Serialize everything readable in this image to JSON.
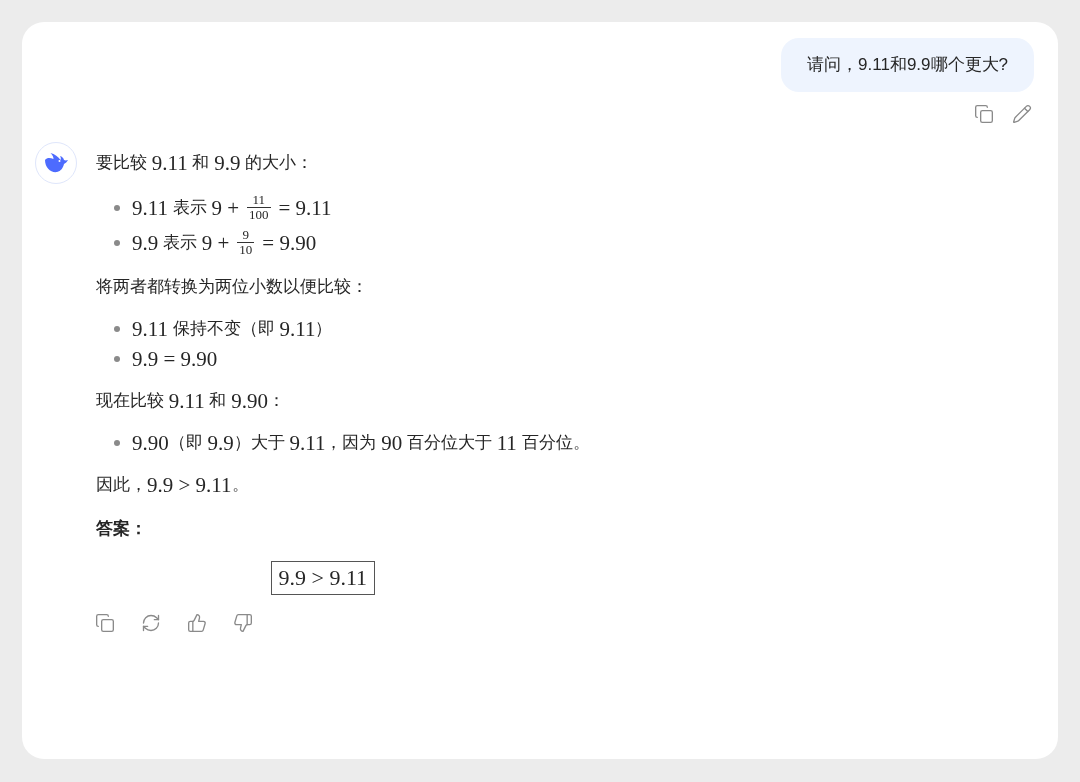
{
  "user_message": {
    "text": "请问，9.11和9.9哪个更大?"
  },
  "user_actions": [
    {
      "kind": "copy"
    },
    {
      "kind": "edit"
    }
  ],
  "answer": [
    {
      "kind": "paragraph",
      "segments": [
        {
          "kind": "text",
          "text": "要比较 "
        },
        {
          "kind": "math",
          "text": "9.11"
        },
        {
          "kind": "text",
          "text": " 和 "
        },
        {
          "kind": "math",
          "text": "9.9"
        },
        {
          "kind": "text",
          "text": " 的大小："
        }
      ]
    },
    {
      "kind": "list",
      "items": [
        [
          {
            "kind": "math",
            "text": "9.11"
          },
          {
            "kind": "text",
            "text": " 表示 "
          },
          {
            "kind": "math",
            "text": "9 +"
          },
          {
            "kind": "frac",
            "num": "11",
            "den": "100"
          },
          {
            "kind": "math",
            "text": "= 9.11"
          }
        ],
        [
          {
            "kind": "math",
            "text": "9.9"
          },
          {
            "kind": "text",
            "text": " 表示 "
          },
          {
            "kind": "math",
            "text": "9 +"
          },
          {
            "kind": "frac",
            "num": "9",
            "den": "10"
          },
          {
            "kind": "math",
            "text": "= 9.90"
          }
        ]
      ]
    },
    {
      "kind": "paragraph",
      "segments": [
        {
          "kind": "text",
          "text": "将两者都转换为两位小数以便比较："
        }
      ]
    },
    {
      "kind": "list",
      "items": [
        [
          {
            "kind": "math",
            "text": "9.11"
          },
          {
            "kind": "text",
            "text": " 保持不变（即 "
          },
          {
            "kind": "math",
            "text": "9.11"
          },
          {
            "kind": "text",
            "text": "）"
          }
        ],
        [
          {
            "kind": "math",
            "text": "9.9 = 9.90"
          }
        ]
      ]
    },
    {
      "kind": "paragraph",
      "segments": [
        {
          "kind": "text",
          "text": "现在比较 "
        },
        {
          "kind": "math",
          "text": "9.11"
        },
        {
          "kind": "text",
          "text": " 和 "
        },
        {
          "kind": "math",
          "text": "9.90"
        },
        {
          "kind": "text",
          "text": "："
        }
      ]
    },
    {
      "kind": "list",
      "items": [
        [
          {
            "kind": "math",
            "text": "9.90"
          },
          {
            "kind": "text",
            "text": "（即 "
          },
          {
            "kind": "math",
            "text": "9.9"
          },
          {
            "kind": "text",
            "text": "）大于 "
          },
          {
            "kind": "math",
            "text": "9.11"
          },
          {
            "kind": "text",
            "text": "，因为 "
          },
          {
            "kind": "math",
            "text": "90"
          },
          {
            "kind": "text",
            "text": " 百分位大于 "
          },
          {
            "kind": "math",
            "text": "11"
          },
          {
            "kind": "text",
            "text": " 百分位。"
          }
        ]
      ]
    },
    {
      "kind": "paragraph",
      "segments": [
        {
          "kind": "text",
          "text": "因此，"
        },
        {
          "kind": "math",
          "text": "9.9 > 9.11"
        },
        {
          "kind": "text",
          "text": "。"
        }
      ]
    },
    {
      "kind": "heading",
      "text": "答案："
    },
    {
      "kind": "boxed",
      "text": "9.9 > 9.11"
    }
  ],
  "answer_actions": [
    {
      "kind": "copy"
    },
    {
      "kind": "regenerate"
    },
    {
      "kind": "like"
    },
    {
      "kind": "dislike"
    }
  ]
}
